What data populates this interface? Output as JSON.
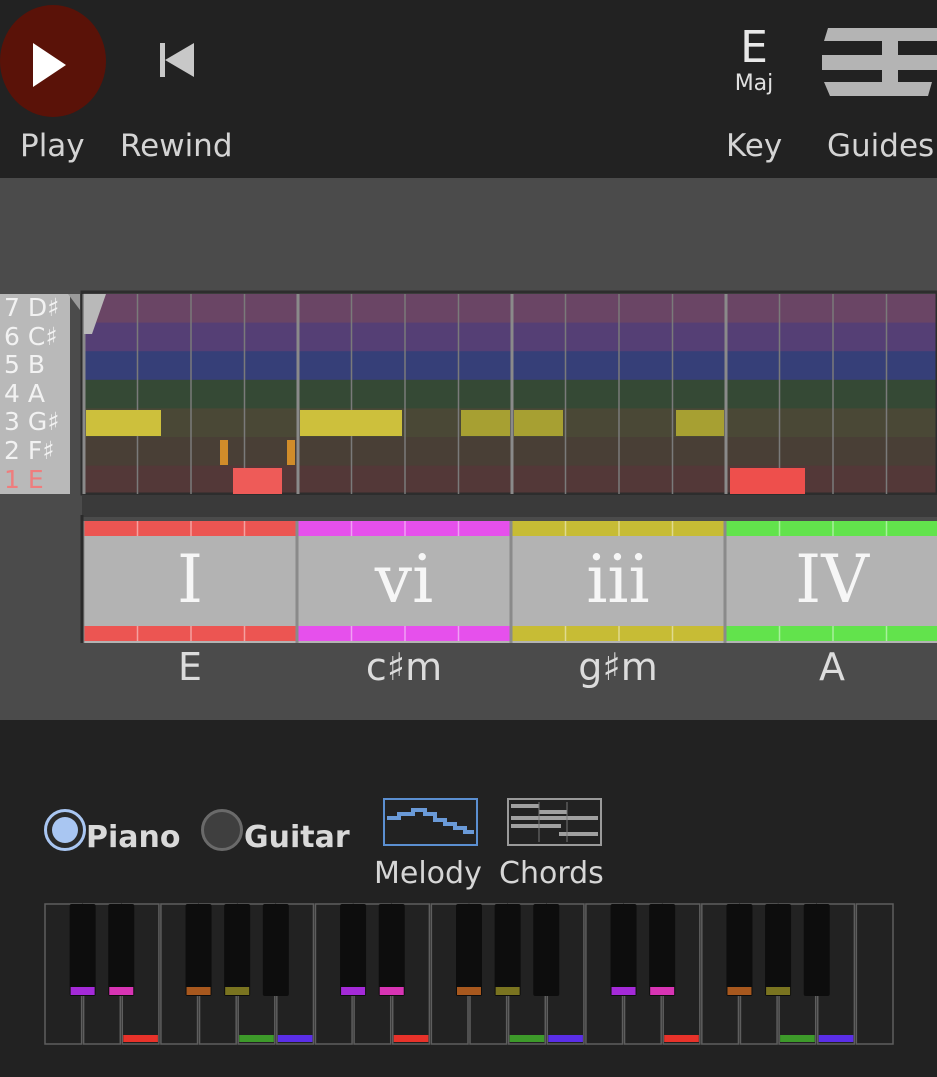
{
  "toolbar": {
    "play_label": "Play",
    "rewind_label": "Rewind",
    "key_label": "Key",
    "guides_label": "Guides",
    "key_value": "E",
    "key_mode": "Maj",
    "play_icon": "play-icon",
    "rewind_icon": "rewind-icon",
    "guides_icon": "guides-icon"
  },
  "melody_grid": {
    "rows": [
      {
        "degree": "7",
        "note": "D♯",
        "color": "#6a4565"
      },
      {
        "degree": "6",
        "note": "C♯",
        "color": "#553f75"
      },
      {
        "degree": "5",
        "note": "B",
        "color": "#363f78"
      },
      {
        "degree": "4",
        "note": "A",
        "color": "#354935"
      },
      {
        "degree": "3",
        "note": "G♯",
        "color": "#4a4836"
      },
      {
        "degree": "2",
        "note": "F♯",
        "color": "#493f36"
      },
      {
        "degree": "1",
        "note": "E",
        "color": "#533838"
      }
    ]
  },
  "progression": [
    {
      "numeral": "I",
      "chord": "E",
      "color": "#ec5552"
    },
    {
      "numeral": "vi",
      "chord": "c♯m",
      "color": "#e650ec"
    },
    {
      "numeral": "iii",
      "chord": "g♯m",
      "color": "#c7bc35"
    },
    {
      "numeral": "IV",
      "chord": "A",
      "color": "#62e34c"
    }
  ],
  "instrument": {
    "piano_label": "Piano",
    "guitar_label": "Guitar",
    "selected": "Piano"
  },
  "views": {
    "melody_label": "Melody",
    "chords_label": "Chords",
    "selected": "Melody"
  }
}
